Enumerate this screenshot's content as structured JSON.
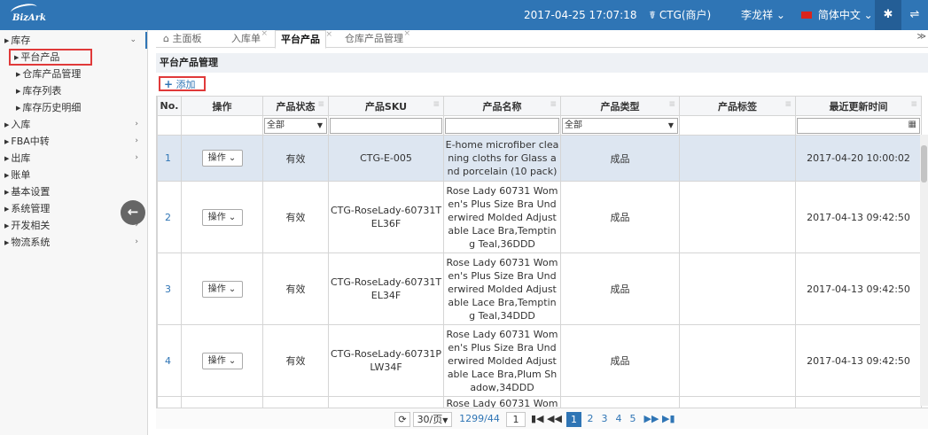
{
  "topbar": {
    "logo_text": "BizArk",
    "datetime": "2017-04-25 17:07:18",
    "account_icon": "user-icon",
    "account": "CTG(商户)",
    "user": "李龙祥",
    "user_caret": "⌄",
    "language": "简体中文",
    "language_caret": "⌄",
    "pin_icon": "pin-icon",
    "swap_icon": "swap-icon"
  },
  "sidebar": {
    "groups": [
      {
        "label": "库存",
        "open": true,
        "subs": [
          "平台产品",
          "仓库产品管理",
          "库存列表",
          "库存历史明细"
        ]
      },
      {
        "label": "入库"
      },
      {
        "label": "FBA中转"
      },
      {
        "label": "出库"
      },
      {
        "label": "账单"
      },
      {
        "label": "基本设置"
      },
      {
        "label": "系统管理"
      },
      {
        "label": "开发相关"
      },
      {
        "label": "物流系统"
      }
    ],
    "active_sub": "平台产品"
  },
  "tabs": [
    {
      "label": "主面板",
      "icon": "home-icon"
    },
    {
      "label": "入库单",
      "close": "×"
    },
    {
      "label": "平台产品",
      "close": "×",
      "active": true
    },
    {
      "label": "仓库产品管理",
      "close": "×"
    }
  ],
  "tabs_more": "≫",
  "section": {
    "title": "平台产品管理",
    "add_label": "添加",
    "add_plus": "+"
  },
  "table": {
    "columns": [
      "No.",
      "操作",
      "产品状态",
      "产品SKU",
      "产品名称",
      "产品类型",
      "产品标签",
      "最近更新时间"
    ],
    "filters": {
      "status": "全部",
      "type": "全部"
    },
    "op_label": "操作",
    "rows": [
      {
        "no": "1",
        "status": "有效",
        "sku": "CTG-E-005",
        "name": "E-home microfiber cleaning cloths for Glass and porcelain (10 pack)",
        "type": "成品",
        "tag": "",
        "updated": "2017-04-20 10:00:02"
      },
      {
        "no": "2",
        "status": "有效",
        "sku": "CTG-RoseLady-60731TEL36F",
        "name": "Rose Lady 60731 Women's Plus Size Bra Underwired Molded Adjustable Lace Bra,Tempting Teal,36DDD",
        "type": "成品",
        "tag": "",
        "updated": "2017-04-13 09:42:50"
      },
      {
        "no": "3",
        "status": "有效",
        "sku": "CTG-RoseLady-60731TEL34F",
        "name": "Rose Lady 60731 Women's Plus Size Bra Underwired Molded Adjustable Lace Bra,Tempting Teal,34DDD",
        "type": "成品",
        "tag": "",
        "updated": "2017-04-13 09:42:50"
      },
      {
        "no": "4",
        "status": "有效",
        "sku": "CTG-RoseLady-60731PLW34F",
        "name": "Rose Lady 60731 Women's Plus Size Bra Underwired Molded Adjustable Lace Bra,Plum Shadow,34DDD",
        "type": "成品",
        "tag": "",
        "updated": "2017-04-13 09:42:50"
      },
      {
        "no": "",
        "status": "",
        "sku": "",
        "name": "Rose Lady 60731 Wom",
        "type": "",
        "tag": "",
        "updated": ""
      }
    ]
  },
  "pager": {
    "refresh_icon": "refresh-icon",
    "per_page": "30/页",
    "summary": "1299/44",
    "current_input": "1",
    "first": "⏮",
    "prev": "◀◀",
    "pages": [
      "1",
      "2",
      "3",
      "4",
      "5"
    ],
    "next": "▶▶",
    "last": "⏭"
  },
  "colors": {
    "brand": "#2f75b5",
    "highlight": "#e03a3a",
    "selected_row": "#dde6f1"
  }
}
